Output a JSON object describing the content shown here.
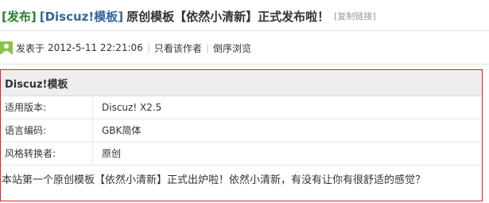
{
  "thread": {
    "prefix": "[发布]",
    "category": "[Discuz!模板]",
    "title": "原创模板【依然小清新】正式发布啦！",
    "copy_link": "[复制链接]"
  },
  "meta": {
    "posted_label": "发表于",
    "posted_time": "2012-5-11 22:21:06",
    "only_author": "只看该作者",
    "reverse_order": "倒序浏览"
  },
  "info_box": {
    "heading": "Discuz!模板",
    "rows": [
      {
        "label": "适用版本:",
        "value": "Discuz!  X2.5"
      },
      {
        "label": "语言编码:",
        "value": "GBK简体"
      },
      {
        "label": "风格转换者:",
        "value": "原创"
      }
    ],
    "body_text": "本站第一个原创模板【依然小清新】正式出炉啦！依然小清新，有没有让你有很舒适的感觉？"
  },
  "colors": {
    "prefix": "#2e7d32",
    "category": "#336699",
    "box_border": "#d12727"
  }
}
